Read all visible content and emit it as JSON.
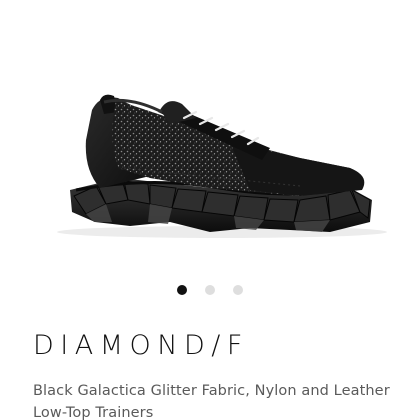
{
  "product": {
    "name": "DIAMOND/F",
    "description": "Black Galactica Glitter Fabric, Nylon and Leather Low-Top Trainers",
    "image_icon": "black-glitter-trainer-image"
  },
  "carousel": {
    "total_slides": 3,
    "active_index": 0
  },
  "colors": {
    "dot_active": "#111111",
    "dot_inactive": "#dedede"
  }
}
